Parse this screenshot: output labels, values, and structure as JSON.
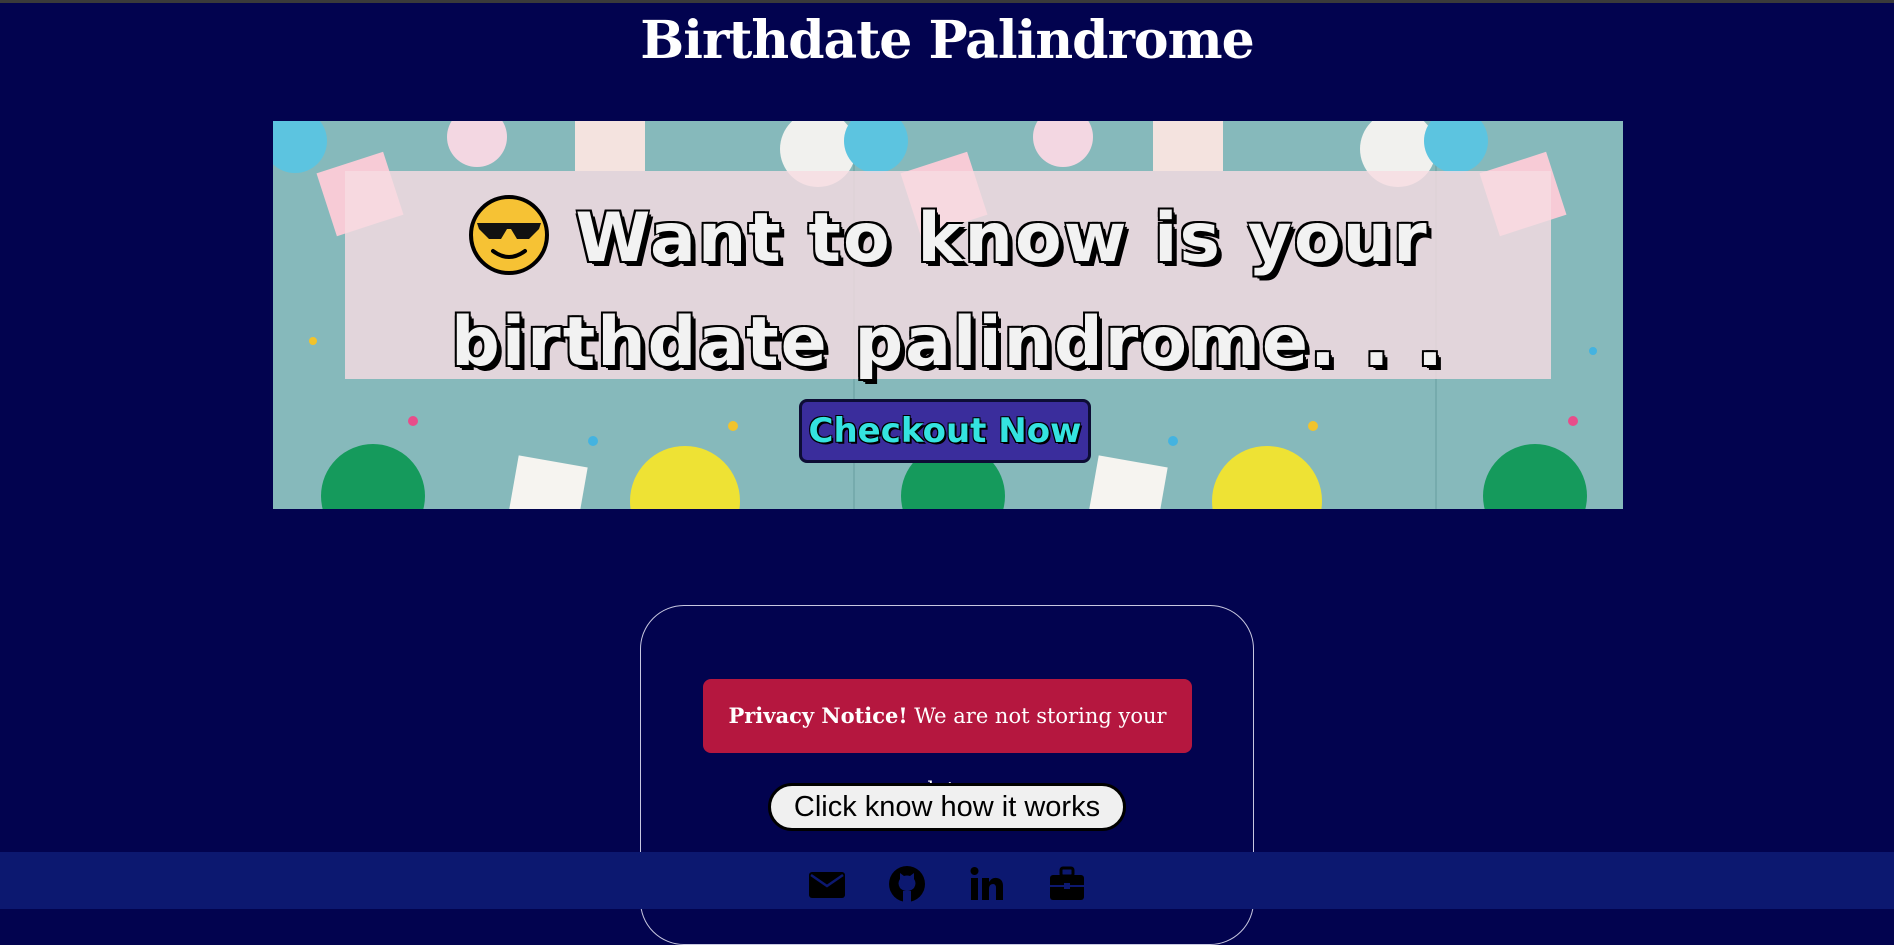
{
  "header": {
    "title": "Birthdate Palindrome"
  },
  "hero": {
    "heading_line1": "Want to know is your",
    "heading_line2": "birthdate palindrome. . .",
    "emoji_icon": "smiling-face-with-sunglasses-icon",
    "cta_label": "Checkout Now"
  },
  "card": {
    "privacy_strong": "Privacy Notice!",
    "privacy_text": " We are not storing your data.",
    "how_button_label": "Click know how it works"
  },
  "footer": {
    "icons": [
      "email-icon",
      "github-icon",
      "linkedin-icon",
      "briefcase-icon"
    ]
  },
  "colors": {
    "page_background": "#02034f",
    "privacy_background": "#b5173f",
    "cta_background": "#3a2d9c",
    "cta_text": "#34e3e0",
    "footer_background": "#0c1870"
  }
}
